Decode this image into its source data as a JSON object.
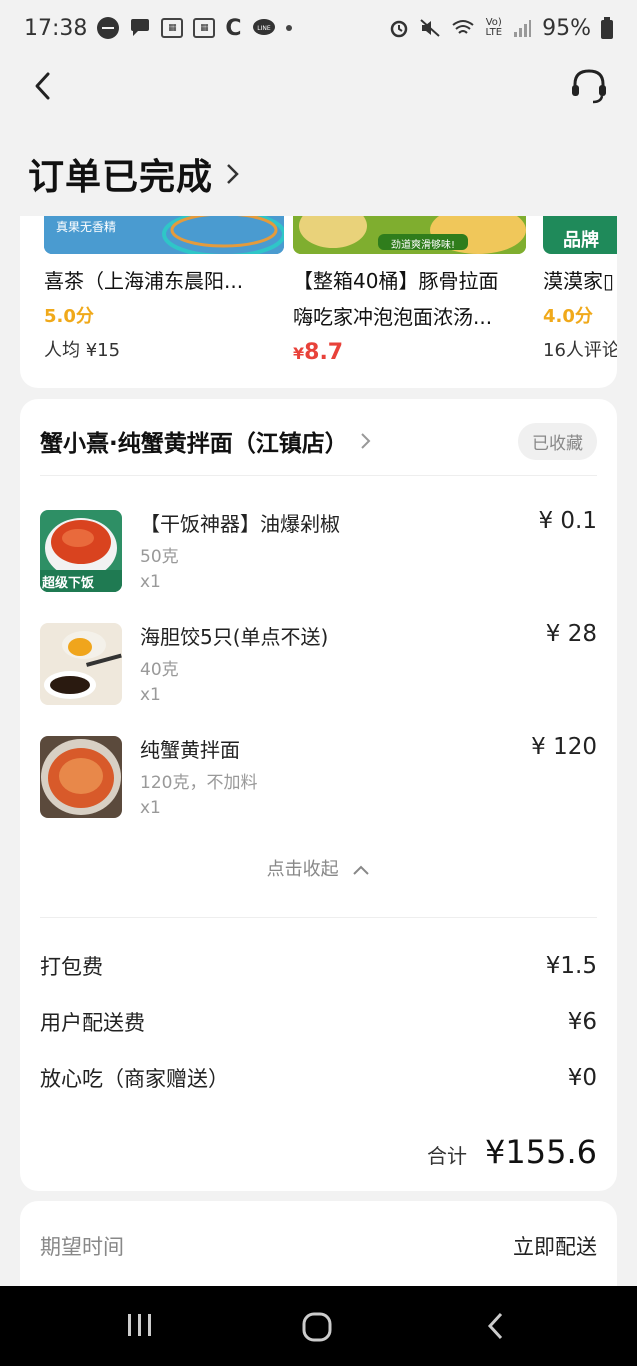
{
  "status": {
    "time": "17:38",
    "battery": "95%"
  },
  "header": {
    "title": "订单已完成"
  },
  "recommendations": [
    {
      "name": "喜茶（上海浦东晨阳...",
      "score": "5.0分",
      "sub": "人均 ¥15",
      "banner": "真果无香精"
    },
    {
      "name_line1": "【整箱40桶】豚骨拉面",
      "name_line2": "嗨吃家冲泡泡面浓汤...",
      "price_symbol": "¥",
      "price": "8.7",
      "banner": "劲道爽滑够味!"
    },
    {
      "name": "漠漠家▯",
      "score": "4.0分",
      "sub": "16人评论",
      "banner": "品牌"
    }
  ],
  "shop": {
    "name": "蟹小熹·纯蟹黄拌面（江镇店）",
    "favorite_label": "已收藏"
  },
  "items": [
    {
      "name": "【干饭神器】油爆剁椒",
      "spec": "50克",
      "qty": "x1",
      "price": "¥ 0.1",
      "badge": "超级下饭"
    },
    {
      "name": "海胆饺5只(单点不送)",
      "spec": "40克",
      "qty": "x1",
      "price": "¥ 28"
    },
    {
      "name": "纯蟹黄拌面",
      "spec": "120克，不加料",
      "qty": "x1",
      "price": "¥ 120"
    }
  ],
  "collapse_label": "点击收起",
  "fees": [
    {
      "label": "打包费",
      "value": "¥1.5"
    },
    {
      "label": "用户配送费",
      "value": "¥6"
    },
    {
      "label": "放心吃（商家赠送）",
      "value": "¥0"
    }
  ],
  "total": {
    "label": "合计",
    "value": "¥155.6"
  },
  "delivery": {
    "label": "期望时间",
    "value": "立即配送"
  },
  "colors": {
    "accent_orange": "#f0a91a",
    "price_red": "#e8423a"
  }
}
